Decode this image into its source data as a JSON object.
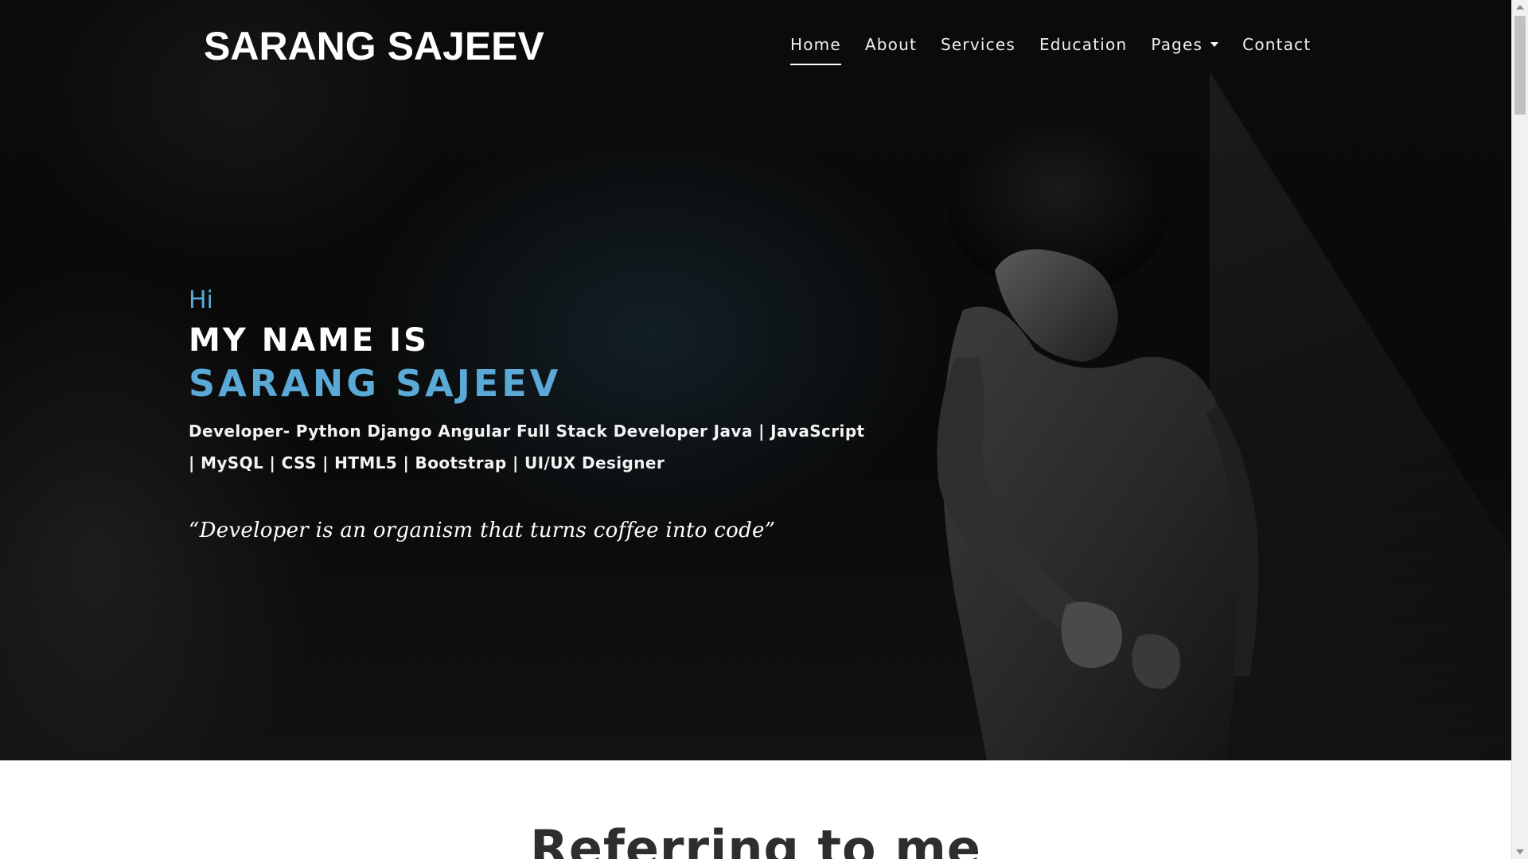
{
  "brand": "SARANG SAJEEV",
  "nav": {
    "items": [
      {
        "label": "Home",
        "active": true
      },
      {
        "label": "About"
      },
      {
        "label": "Services"
      },
      {
        "label": "Education"
      },
      {
        "label": "Pages",
        "dropdown": true
      },
      {
        "label": "Contact"
      }
    ]
  },
  "hero": {
    "greeting": "Hi",
    "name_lead": "MY NAME IS",
    "name": "SARANG SAJEEV",
    "tagline": "Developer- Python Django Angular Full Stack Developer Java | JavaScript | MySQL | CSS | HTML5 | Bootstrap | UI/UX Designer",
    "quote": "“Developer is an organism that turns coffee into code”"
  },
  "section": {
    "title": "Referring to me"
  },
  "colors": {
    "accent": "#5aa9d6",
    "hero_bg": "#0b0b0b",
    "heading_dark": "#2e2e2e"
  }
}
